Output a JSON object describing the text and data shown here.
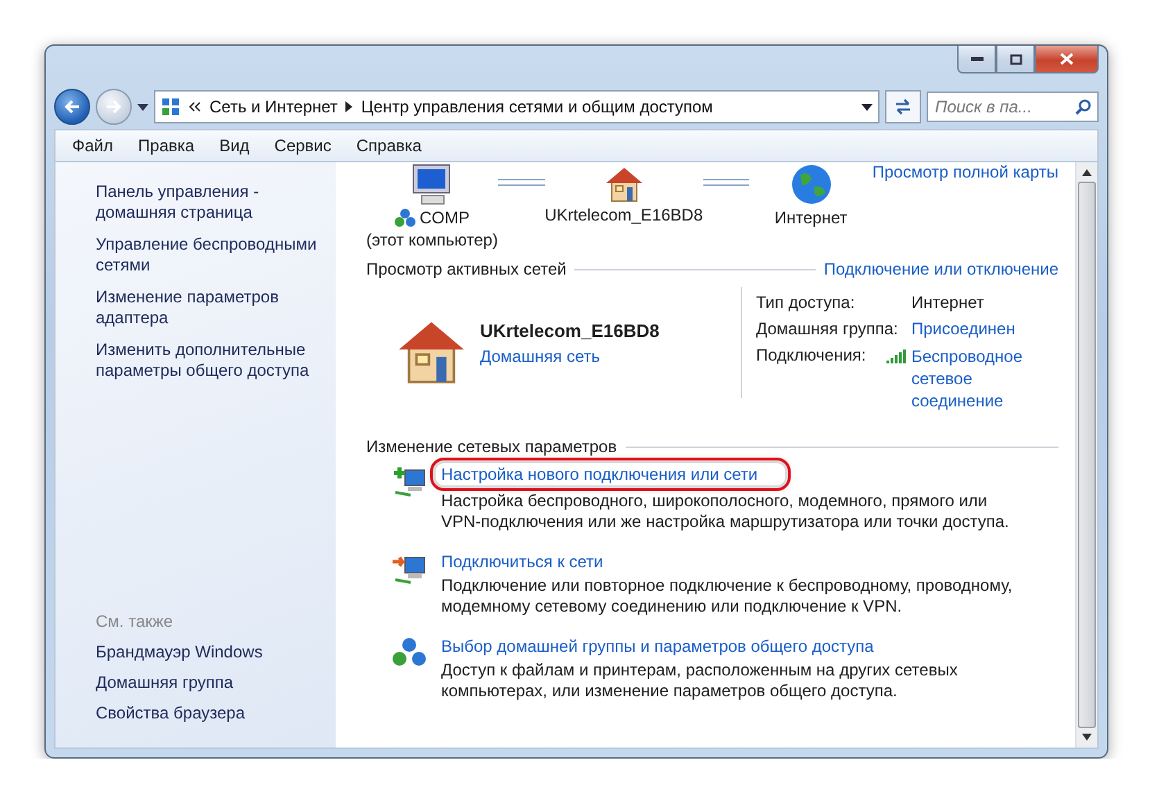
{
  "nav": {
    "breadcrumb": [
      "Сеть и Интернет",
      "Центр управления сетями и общим доступом"
    ],
    "search_placeholder": "Поиск в па..."
  },
  "menu": [
    "Файл",
    "Правка",
    "Вид",
    "Сервис",
    "Справка"
  ],
  "sidebar": {
    "links": [
      "Панель управления - домашняя страница",
      "Управление беспроводными сетями",
      "Изменение параметров адаптера",
      "Изменить дополнительные параметры общего доступа"
    ],
    "see_also_title": "См. также",
    "see_also": [
      "Брандмауэр Windows",
      "Домашняя группа",
      "Свойства браузера"
    ]
  },
  "map": {
    "nodes": [
      {
        "kind": "computer",
        "label": "COMP",
        "sublabel": "(этот компьютер)"
      },
      {
        "kind": "house",
        "label": "UKrtelecom_E16BD8"
      },
      {
        "kind": "globe",
        "label": "Интернет"
      }
    ],
    "full_map_link": "Просмотр полной карты"
  },
  "active": {
    "title": "Просмотр активных сетей",
    "link": "Подключение или отключение",
    "network": {
      "name": "UKrtelecom_E16BD8",
      "type": "Домашняя сеть"
    },
    "props": [
      {
        "label": "Тип доступа:",
        "value": "Интернет",
        "kind": "text"
      },
      {
        "label": "Домашняя группа:",
        "value": "Присоединен",
        "kind": "link"
      },
      {
        "label": "Подключения:",
        "value": "Беспроводное сетевое соединение",
        "kind": "signal"
      }
    ]
  },
  "change": {
    "title": "Изменение сетевых параметров",
    "tasks": [
      {
        "kind": "new",
        "link": "Настройка нового подключения или сети",
        "description": "Настройка беспроводного, широкополосного, модемного, прямого или VPN-подключения или же настройка маршрутизатора или точки доступа.",
        "highlighted": true
      },
      {
        "kind": "connect",
        "link": "Подключиться к сети",
        "description": "Подключение или повторное подключение к беспроводному, проводному, модемному сетевому соединению или подключение к VPN.",
        "highlighted": false
      },
      {
        "kind": "share",
        "link": "Выбор домашней группы и параметров общего доступа",
        "description": "Доступ к файлам и принтерам, расположенным на других сетевых компьютерах, или изменение параметров общего доступа.",
        "highlighted": false
      }
    ]
  }
}
